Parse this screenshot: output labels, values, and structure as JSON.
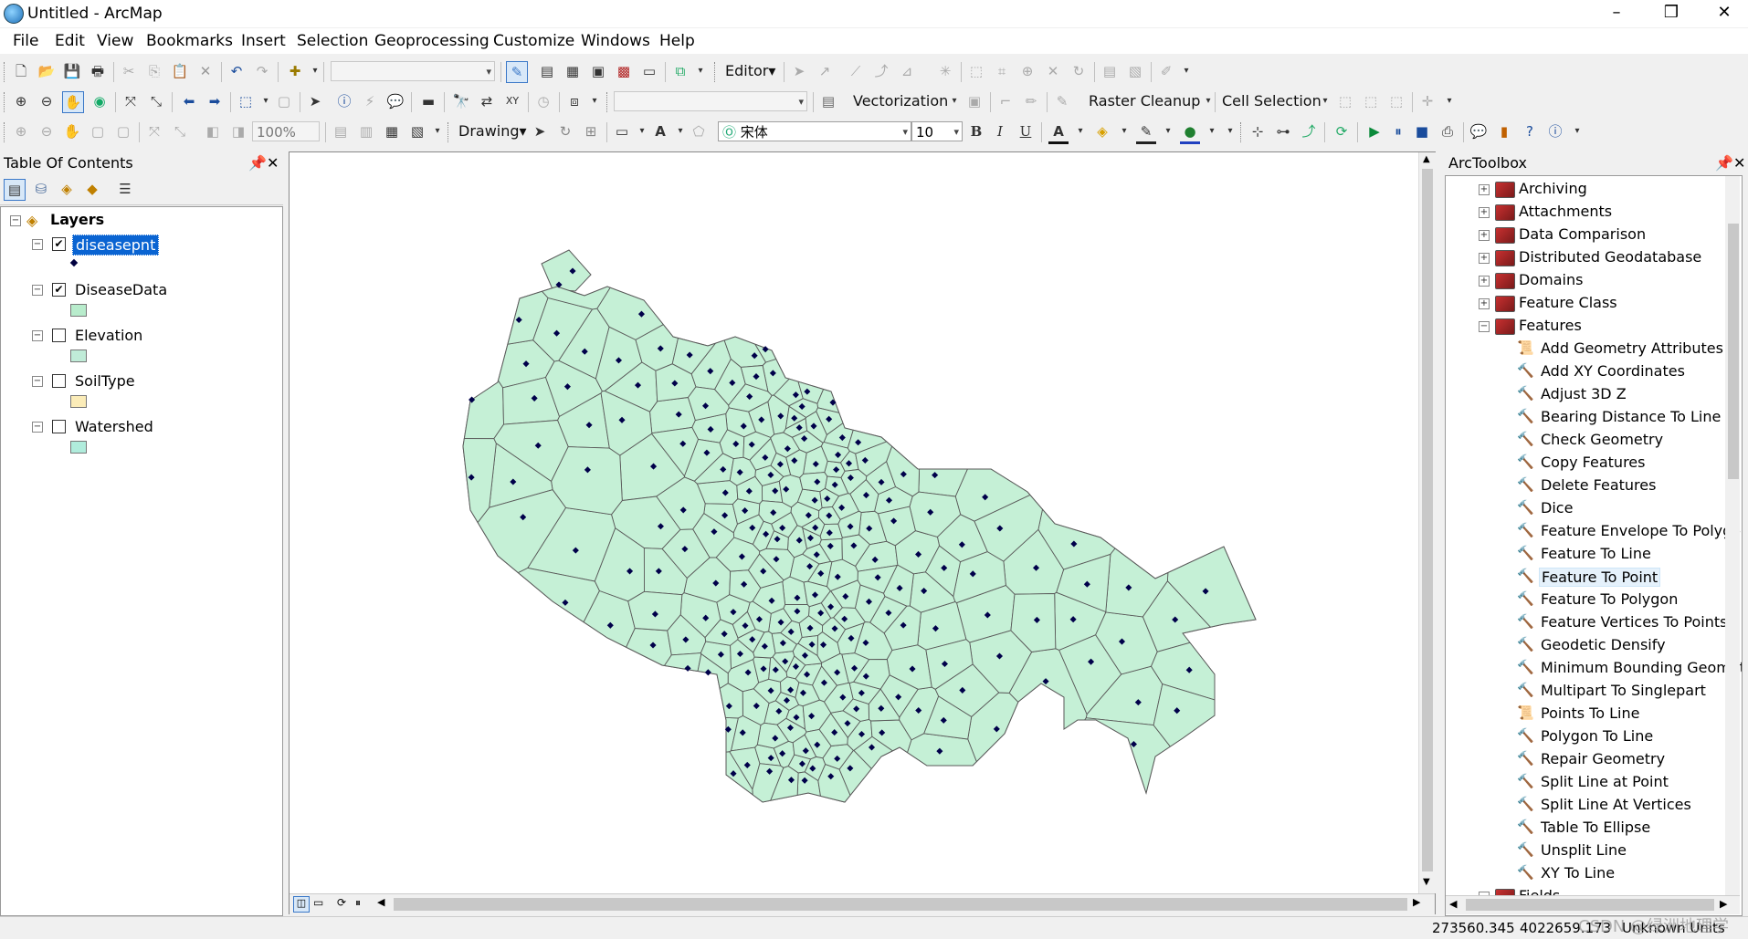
{
  "window": {
    "title": "Untitled - ArcMap",
    "min_glyph": "–",
    "max_glyph": "❒",
    "close_glyph": "✕"
  },
  "menu": [
    "File",
    "Edit",
    "View",
    "Bookmarks",
    "Insert",
    "Selection",
    "Geoprocessing",
    "Customize",
    "Windows",
    "Help"
  ],
  "toolbar1": {
    "editor_label": "Editor▾",
    "scale_value": ""
  },
  "toolbar2": {
    "vectorization_label": "Vectorization",
    "raster_cleanup_label": "Raster Cleanup",
    "cell_selection_label": "Cell Selection"
  },
  "toolbar3": {
    "zoom_value": "100%",
    "drawing_label": "Drawing▾",
    "font_value": "宋体",
    "font_size": "10",
    "bold": "B",
    "italic": "I",
    "underline": "U",
    "font_color_letter": "A"
  },
  "toc": {
    "title": "Table Of Contents",
    "pin": "⌂",
    "close": "✕",
    "root_label": "Layers",
    "layers": [
      {
        "name": "diseasepnt",
        "checked": true,
        "selected": true,
        "symbol": "point",
        "swatch": "#000040"
      },
      {
        "name": "DiseaseData",
        "checked": true,
        "selected": false,
        "symbol": "fill",
        "swatch": "#b8eccc"
      },
      {
        "name": "Elevation",
        "checked": false,
        "selected": false,
        "symbol": "fill",
        "swatch": "#c0ecd8"
      },
      {
        "name": "SoilType",
        "checked": false,
        "selected": false,
        "symbol": "fill",
        "swatch": "#fbecb8"
      },
      {
        "name": "Watershed",
        "checked": false,
        "selected": false,
        "symbol": "fill",
        "swatch": "#b0ecdc"
      }
    ]
  },
  "map": {
    "polygon_fill": "#c5f0d6",
    "polygon_stroke": "#5a5a5a",
    "point_color": "#00004a"
  },
  "arctoolbox": {
    "title": "ArcToolbox",
    "toolsets": [
      "Archiving",
      "Attachments",
      "Data Comparison",
      "Distributed Geodatabase",
      "Domains",
      "Feature Class"
    ],
    "expanded_toolset": "Features",
    "tools": [
      {
        "name": "Add Geometry Attributes",
        "icon": "script"
      },
      {
        "name": "Add XY Coordinates",
        "icon": "hammer"
      },
      {
        "name": "Adjust 3D Z",
        "icon": "hammer"
      },
      {
        "name": "Bearing Distance To Line",
        "icon": "hammer"
      },
      {
        "name": "Check Geometry",
        "icon": "hammer"
      },
      {
        "name": "Copy Features",
        "icon": "hammer"
      },
      {
        "name": "Delete Features",
        "icon": "hammer"
      },
      {
        "name": "Dice",
        "icon": "hammer"
      },
      {
        "name": "Feature Envelope To Polygon",
        "icon": "hammer"
      },
      {
        "name": "Feature To Line",
        "icon": "hammer"
      },
      {
        "name": "Feature To Point",
        "icon": "hammer",
        "highlighted": true
      },
      {
        "name": "Feature To Polygon",
        "icon": "hammer"
      },
      {
        "name": "Feature Vertices To Points",
        "icon": "hammer"
      },
      {
        "name": "Geodetic Densify",
        "icon": "hammer"
      },
      {
        "name": "Minimum Bounding Geometry",
        "icon": "hammer"
      },
      {
        "name": "Multipart To Singlepart",
        "icon": "hammer"
      },
      {
        "name": "Points To Line",
        "icon": "script"
      },
      {
        "name": "Polygon To Line",
        "icon": "hammer"
      },
      {
        "name": "Repair Geometry",
        "icon": "hammer"
      },
      {
        "name": "Split Line at Point",
        "icon": "hammer"
      },
      {
        "name": "Split Line At Vertices",
        "icon": "hammer"
      },
      {
        "name": "Table To Ellipse",
        "icon": "hammer"
      },
      {
        "name": "Unsplit Line",
        "icon": "hammer"
      },
      {
        "name": "XY To Line",
        "icon": "hammer"
      }
    ],
    "next_toolset_partial": "Fields"
  },
  "status": {
    "x": "273560.345",
    "y": "4022659.173",
    "units": "Unknown Units",
    "watermark": "CSDN @绿洲地理学"
  }
}
